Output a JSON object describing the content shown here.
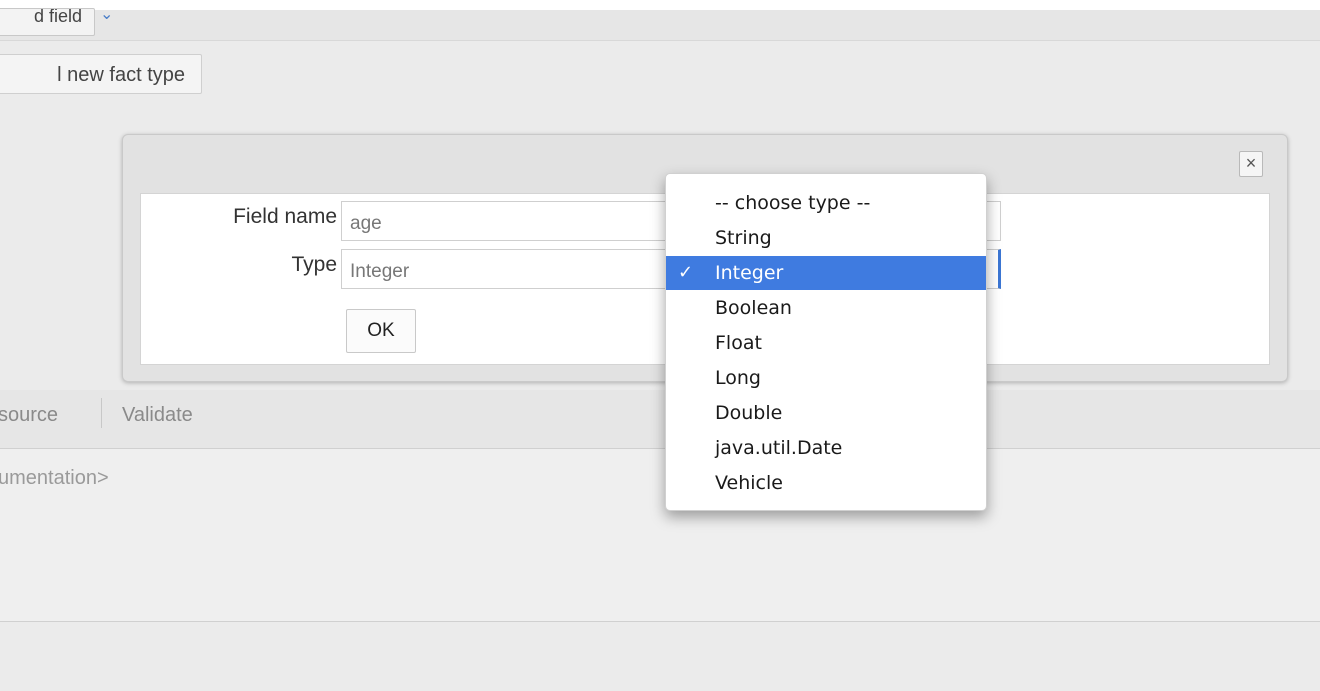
{
  "toolbar": {
    "add_field_label": "d field",
    "add_fact_type_label": "l new fact type"
  },
  "dialog": {
    "field_name_label": "Field name",
    "field_name_value": "age",
    "type_label": "Type",
    "type_value": "Integer",
    "ok_label": "OK",
    "close_symbol": "×"
  },
  "dropdown": {
    "check_mark": "✓",
    "options": [
      "-- choose type --",
      "String",
      "Integer",
      "Boolean",
      "Float",
      "Long",
      "Double",
      "java.util.Date",
      "Vehicle"
    ],
    "selected_index": 2
  },
  "tabs": {
    "source_label": "source",
    "validate_label": "Validate"
  },
  "documentation": {
    "placeholder": "umentation>"
  },
  "colors": {
    "selection": "#3f7be0",
    "background": "#ebebeb"
  }
}
